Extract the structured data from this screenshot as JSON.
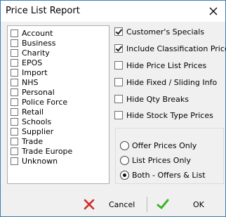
{
  "window": {
    "title": "Price List Report"
  },
  "categories": [
    {
      "label": "Account",
      "checked": false
    },
    {
      "label": "Business",
      "checked": false
    },
    {
      "label": "Charity",
      "checked": false
    },
    {
      "label": "EPOS",
      "checked": false
    },
    {
      "label": "Import",
      "checked": false
    },
    {
      "label": "NHS",
      "checked": false
    },
    {
      "label": "Personal",
      "checked": false
    },
    {
      "label": "Police Force",
      "checked": false
    },
    {
      "label": "Retail",
      "checked": false
    },
    {
      "label": "Schools",
      "checked": false
    },
    {
      "label": "Supplier",
      "checked": false
    },
    {
      "label": "Trade",
      "checked": false
    },
    {
      "label": "Trade Europe",
      "checked": false
    },
    {
      "label": "Unknown",
      "checked": false
    }
  ],
  "options": [
    {
      "label": "Customer's Specials",
      "checked": true
    },
    {
      "label": "Include Classification Prices",
      "checked": true
    },
    {
      "label": "Hide Price List Prices",
      "checked": false
    },
    {
      "label": "Hide Fixed / Sliding Info",
      "checked": false
    },
    {
      "label": "Hide Qty Breaks",
      "checked": false
    },
    {
      "label": "Hide Stock Type Prices",
      "checked": false
    }
  ],
  "price_mode": {
    "choices": [
      {
        "label": "Offer Prices Only",
        "selected": false
      },
      {
        "label": "List Prices Only",
        "selected": false
      },
      {
        "label": "Both - Offers & List",
        "selected": true
      }
    ]
  },
  "buttons": {
    "cancel_label": "Cancel",
    "ok_label": "OK"
  },
  "colors": {
    "cancel_icon": "#d42a2a",
    "ok_icon": "#3cb52a"
  }
}
